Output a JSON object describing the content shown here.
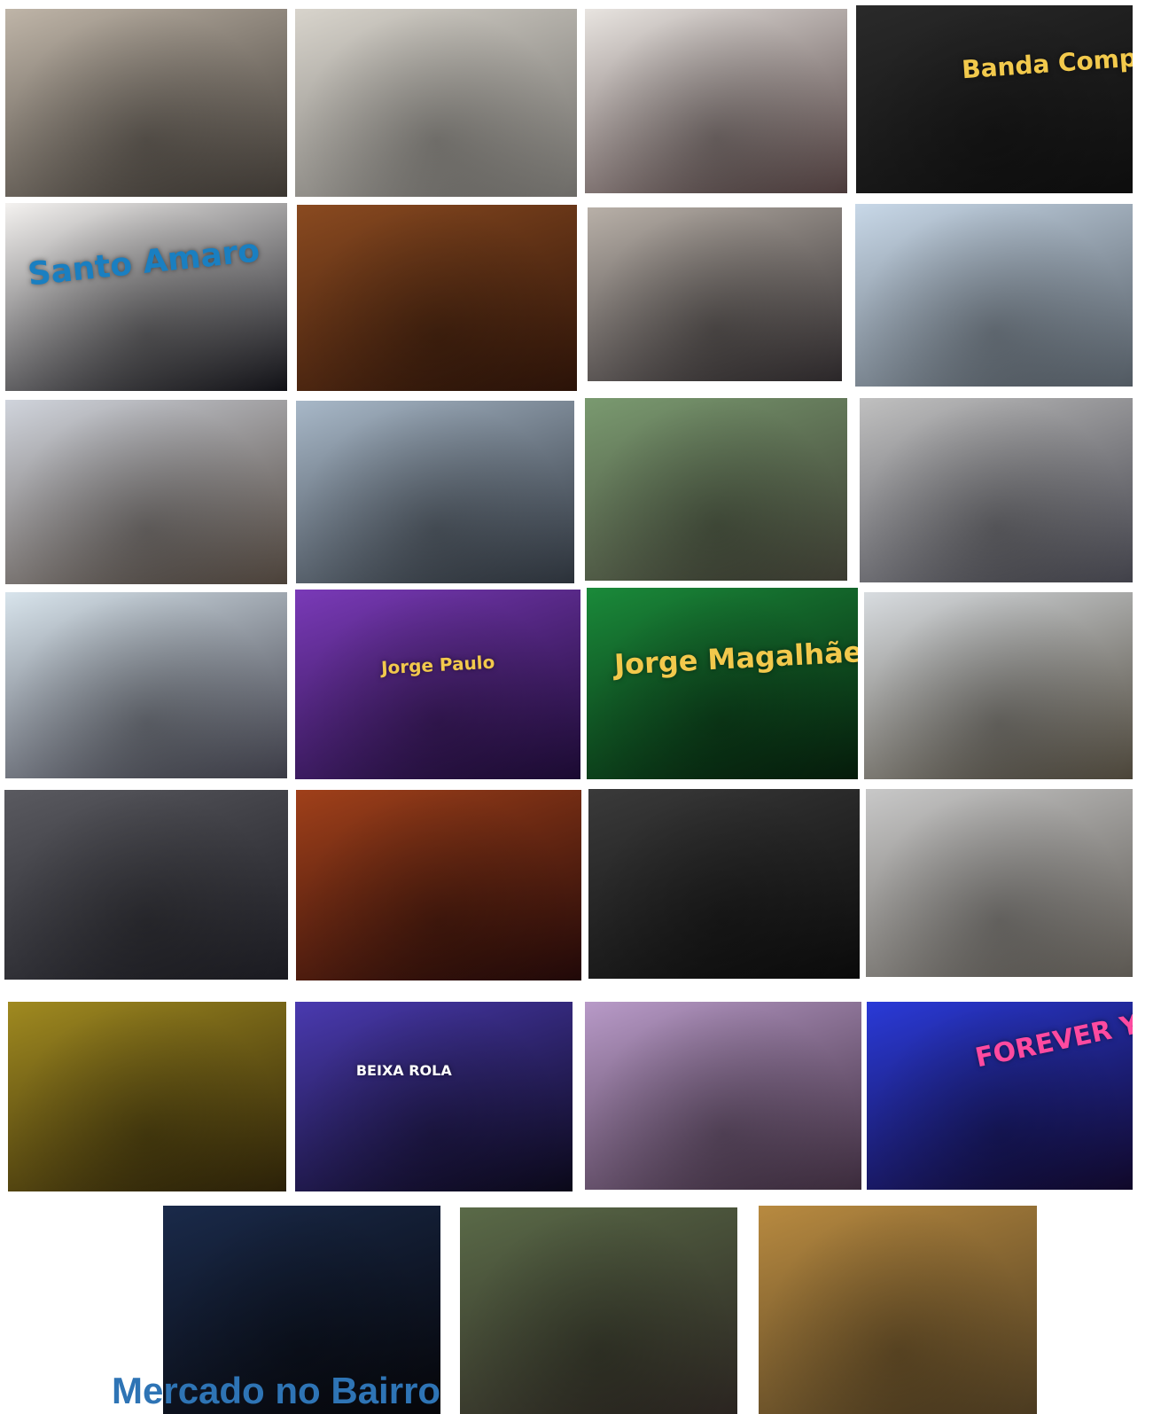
{
  "caption": "Mercado no Bairro",
  "photos": [
    {
      "id": "drummers-square",
      "bg": [
        "#bfb5a8",
        "#3a3530"
      ]
    },
    {
      "id": "street-walkers",
      "bg": [
        "#d8d4cc",
        "#6c6a66"
      ]
    },
    {
      "id": "heart-balloon",
      "bg": [
        "#e8e4e0",
        "#4a3a3a"
      ]
    },
    {
      "id": "banda-compacto-stage",
      "bg": [
        "#2a2a2a",
        "#0d0d0d"
      ],
      "text": "Banda Compacto",
      "text_color": "#f2c94c"
    },
    {
      "id": "romaria-dj",
      "bg": [
        "#f4f2f0",
        "#101015"
      ],
      "text": "Santo Amaro",
      "text_color": "#1a7fc1"
    },
    {
      "id": "crowd-hat-man",
      "bg": [
        "#8a4a20",
        "#2a1208"
      ]
    },
    {
      "id": "folk-dancers-black",
      "bg": [
        "#b8b0a8",
        "#2a2628"
      ]
    },
    {
      "id": "sete-cabecas-banner",
      "bg": [
        "#c8d8e8",
        "#505860"
      ]
    },
    {
      "id": "folk-group-tents",
      "bg": [
        "#d0d4dc",
        "#4a4038"
      ]
    },
    {
      "id": "children-dancing",
      "bg": [
        "#a8b8c8",
        "#2a3038"
      ]
    },
    {
      "id": "women-exercising",
      "bg": [
        "#7a9a70",
        "#3a3a30"
      ]
    },
    {
      "id": "couple-bridge-backdrop",
      "bg": [
        "#c0c0c0",
        "#404048"
      ]
    },
    {
      "id": "uas-stand",
      "bg": [
        "#d8e4ec",
        "#3a3a44"
      ]
    },
    {
      "id": "jorge-paulo-stage",
      "bg": [
        "#7a3ab8",
        "#1a0a30"
      ],
      "text": "Jorge Paulo",
      "text_color": "#f2c94c"
    },
    {
      "id": "jorge-magalhaes-stage",
      "bg": [
        "#1a8a3a",
        "#051a0a"
      ],
      "text": "Jorge Magalhães",
      "text_color": "#f2c94c"
    },
    {
      "id": "yellow-ball-fair",
      "bg": [
        "#d8dce0",
        "#4a4438"
      ]
    },
    {
      "id": "green-team-award",
      "bg": [
        "#5a5a60",
        "#1a1a20"
      ]
    },
    {
      "id": "singers-stage-orange",
      "bg": [
        "#a0401a",
        "#200808"
      ]
    },
    {
      "id": "folk-band-stage",
      "bg": [
        "#3a3a3a",
        "#0a0a0a"
      ]
    },
    {
      "id": "church-ruins-dance",
      "bg": [
        "#c8c8c8",
        "#5a5650"
      ]
    },
    {
      "id": "selfie-crowd-yellow",
      "bg": [
        "#a08a20",
        "#2a2008"
      ]
    },
    {
      "id": "beixa-rola-concert",
      "bg": [
        "#4a3ab0",
        "#0a0818"
      ],
      "text": "BEIXA ROLA",
      "text_color": "#ffffff"
    },
    {
      "id": "stage-selfie-crowd",
      "bg": [
        "#b89ac8",
        "#3a2a3a"
      ]
    },
    {
      "id": "forever-young-dj",
      "bg": [
        "#2a3ad8",
        "#100828"
      ],
      "text": "FOREVER YOUNG",
      "text_color": "#ff4aa0"
    },
    {
      "id": "singer-blue-light",
      "bg": [
        "#1a2a4a",
        "#050508"
      ]
    },
    {
      "id": "evening-dining-crowd",
      "bg": [
        "#5a6a48",
        "#2a2420"
      ]
    },
    {
      "id": "aerial-folk-parade",
      "bg": [
        "#b88a40",
        "#4a3a20"
      ]
    }
  ]
}
